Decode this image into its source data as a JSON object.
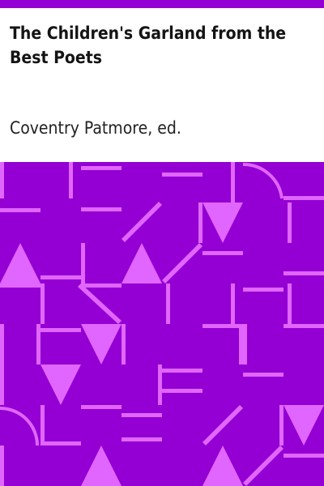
{
  "cover": {
    "title": "The Children's Garland from the Best Poets",
    "author": "Coventry Patmore, ed."
  },
  "colors": {
    "band": "#9400d3",
    "pattern_background": "#9400d3",
    "pattern_lines": "#e066ff",
    "text": "#141414",
    "page": "#ffffff"
  }
}
